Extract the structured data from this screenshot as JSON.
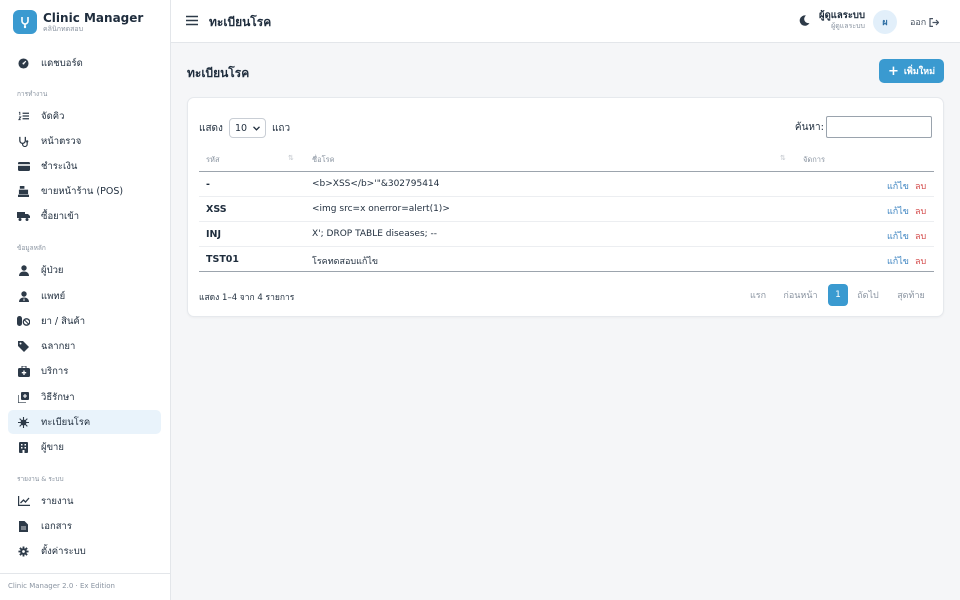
{
  "brand": {
    "title": "Clinic Manager",
    "subtitle": "คลินิกทดสอบ"
  },
  "sidebar": {
    "dashboard": "แดชบอร์ด",
    "group_ops": "การทำงาน",
    "queue": "จัดคิว",
    "exam": "หน้าตรวจ",
    "payment": "ชำระเงิน",
    "pos": "ขายหน้าร้าน (POS)",
    "purchase": "ซื้อยาเข้า",
    "group_master": "ข้อมูลหลัก",
    "patients": "ผู้ป่วย",
    "doctors": "แพทย์",
    "products": "ยา / สินค้า",
    "labels": "ฉลากยา",
    "services": "บริการ",
    "treatments": "วิธีรักษา",
    "diseases": "ทะเบียนโรค",
    "sellers": "ผู้ขาย",
    "group_reports": "รายงาน & ระบบ",
    "reports": "รายงาน",
    "documents": "เอกสาร",
    "settings": "ตั้งค่าระบบ",
    "footer": "Clinic Manager 2.0 · Ex Edition"
  },
  "topbar": {
    "title": "ทะเบียนโรค",
    "user_name": "ผู้ดูแลระบบ",
    "user_role": "ผู้ดูแลระบบ",
    "avatar_initial": "ผ",
    "logout": "ออก"
  },
  "page": {
    "title": "ทะเบียนโรค",
    "add_button": "เพิ่มใหม่"
  },
  "table_controls": {
    "show_label": "แสดง",
    "page_size": "10",
    "rows_label": "แถว",
    "search_label": "ค้นหา:",
    "search_value": ""
  },
  "table": {
    "headers": {
      "code": "รหัส",
      "name": "ชื่อโรค",
      "actions": "จัดการ"
    },
    "rows": [
      {
        "code": "-",
        "name": "<b>XSS</b>'\"&302795414",
        "edit": "แก้ไข",
        "delete": "ลบ"
      },
      {
        "code": "XSS",
        "name": "<img src=x onerror=alert(1)>",
        "edit": "แก้ไข",
        "delete": "ลบ"
      },
      {
        "code": "INJ",
        "name": "X'; DROP TABLE diseases; --",
        "edit": "แก้ไข",
        "delete": "ลบ"
      },
      {
        "code": "TST01",
        "name": "โรคทดสอบแก้ไข",
        "edit": "แก้ไข",
        "delete": "ลบ"
      }
    ]
  },
  "footer_info": "แสดง 1–4 จาก 4 รายการ",
  "pagination": {
    "first": "แรก",
    "prev": "ก่อนหน้า",
    "current": "1",
    "next": "ถัดไป",
    "last": "สุดท้าย"
  },
  "colors": {
    "primary": "#3a9ad0",
    "danger": "#d44b4b",
    "link": "#3a82c0",
    "active_bg": "#e9f3fb"
  },
  "icons": {
    "dashboard": "gauge-icon",
    "queue": "list-ordered-icon",
    "exam": "stethoscope-icon",
    "payment": "credit-card-icon",
    "pos": "cash-register-icon",
    "purchase": "truck-icon",
    "patients": "user-icon",
    "doctors": "user-doctor-icon",
    "products": "pills-icon",
    "labels": "tag-icon",
    "services": "kit-medical-icon",
    "treatments": "notes-medical-icon",
    "diseases": "virus-icon",
    "sellers": "building-icon",
    "reports": "chart-line-icon",
    "documents": "file-icon",
    "settings": "gear-icon"
  }
}
